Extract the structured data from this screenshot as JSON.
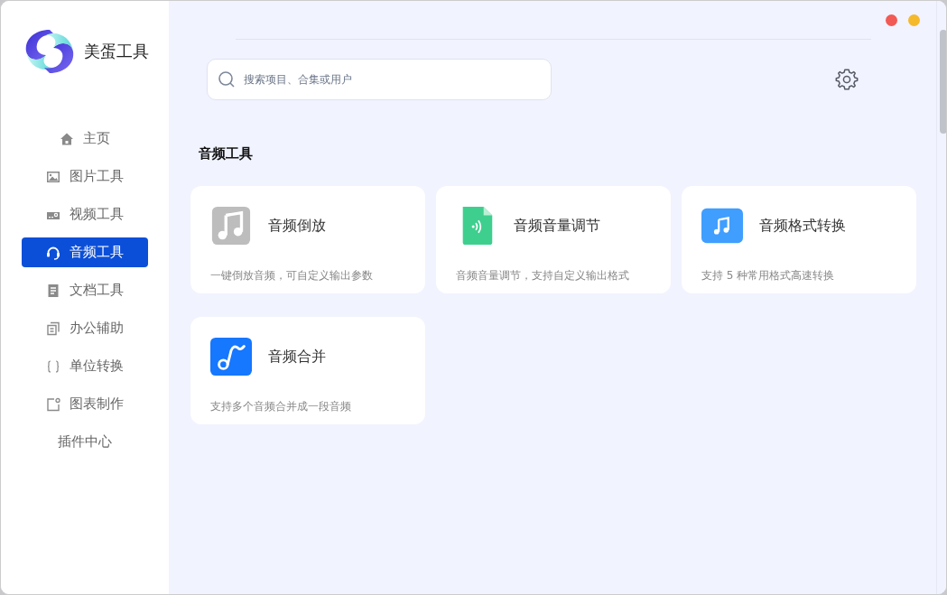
{
  "app": {
    "name": "美蛋工具"
  },
  "sidebar": {
    "items": [
      {
        "label": "主页",
        "selected": false
      },
      {
        "label": "图片工具",
        "selected": false
      },
      {
        "label": "视频工具",
        "selected": false
      },
      {
        "label": "音频工具",
        "selected": true
      },
      {
        "label": "文档工具",
        "selected": false
      },
      {
        "label": "办公辅助",
        "selected": false
      },
      {
        "label": "单位转换",
        "selected": false
      },
      {
        "label": "图表制作",
        "selected": false
      },
      {
        "label": "插件中心",
        "selected": false
      }
    ]
  },
  "search": {
    "placeholder": "搜索项目、合集或用户"
  },
  "section": {
    "title": "音频工具"
  },
  "cards": [
    {
      "title": "音频倒放",
      "description": "一键倒放音频，可自定义输出参数"
    },
    {
      "title": "音频音量调节",
      "description": "音频音量调节，支持自定义输出格式"
    },
    {
      "title": "音频格式转换",
      "description": "支持 5 种常用格式高速转换"
    },
    {
      "title": "音频合并",
      "description": "支持多个音频合并成一段音频"
    }
  ]
}
